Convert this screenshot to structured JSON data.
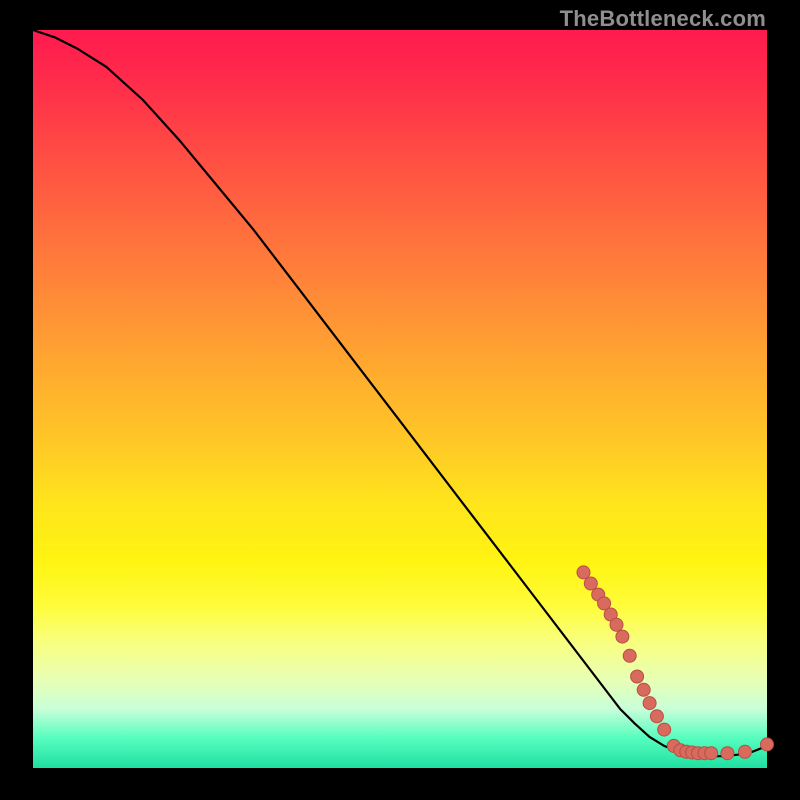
{
  "watermark": "TheBottleneck.com",
  "colors": {
    "background": "#000000",
    "curve": "#000000",
    "marker_fill": "#d96a5e",
    "marker_stroke": "#b94e44"
  },
  "chart_data": {
    "type": "line",
    "title": "",
    "xlabel": "",
    "ylabel": "",
    "xlim": [
      0,
      100
    ],
    "ylim": [
      0,
      100
    ],
    "grid": false,
    "legend": false,
    "series": [
      {
        "name": "bottleneck-curve",
        "x": [
          0,
          3,
          6,
          10,
          15,
          20,
          25,
          30,
          35,
          40,
          45,
          50,
          55,
          60,
          65,
          70,
          75,
          80,
          82,
          84,
          86,
          88,
          90,
          92,
          94,
          96,
          98,
          100
        ],
        "y": [
          100,
          99,
          97.5,
          95,
          90.5,
          85,
          79,
          73,
          66.5,
          60,
          53.5,
          47,
          40.5,
          34,
          27.5,
          21,
          14.5,
          8,
          6,
          4.2,
          3,
          2.2,
          1.8,
          1.6,
          1.6,
          1.8,
          2.2,
          3
        ]
      }
    ],
    "markers": [
      {
        "x": 75.0,
        "y": 26.5
      },
      {
        "x": 76.0,
        "y": 25.0
      },
      {
        "x": 77.0,
        "y": 23.5
      },
      {
        "x": 77.8,
        "y": 22.3
      },
      {
        "x": 78.7,
        "y": 20.8
      },
      {
        "x": 79.5,
        "y": 19.4
      },
      {
        "x": 80.3,
        "y": 17.8
      },
      {
        "x": 81.3,
        "y": 15.2
      },
      {
        "x": 82.3,
        "y": 12.4
      },
      {
        "x": 83.2,
        "y": 10.6
      },
      {
        "x": 84.0,
        "y": 8.8
      },
      {
        "x": 85.0,
        "y": 7.0
      },
      {
        "x": 86.0,
        "y": 5.2
      },
      {
        "x": 87.3,
        "y": 3.0
      },
      {
        "x": 88.2,
        "y": 2.4
      },
      {
        "x": 89.0,
        "y": 2.2
      },
      {
        "x": 89.8,
        "y": 2.1
      },
      {
        "x": 90.6,
        "y": 2.0
      },
      {
        "x": 91.5,
        "y": 2.0
      },
      {
        "x": 92.4,
        "y": 2.0
      },
      {
        "x": 94.6,
        "y": 2.0
      },
      {
        "x": 97.0,
        "y": 2.2
      },
      {
        "x": 100.0,
        "y": 3.2
      }
    ]
  }
}
